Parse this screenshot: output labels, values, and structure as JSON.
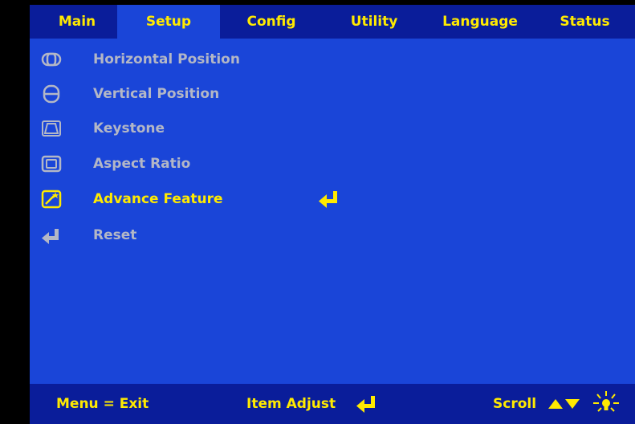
{
  "tabs": [
    {
      "label": "Main",
      "active": false
    },
    {
      "label": "Setup",
      "active": true
    },
    {
      "label": "Config",
      "active": false
    },
    {
      "label": "Utility",
      "active": false
    },
    {
      "label": "Language",
      "active": false
    },
    {
      "label": "Status",
      "active": false
    }
  ],
  "menu": {
    "items": [
      {
        "label": "Horizontal Position",
        "icon": "horizontal-position-icon",
        "state": "dim"
      },
      {
        "label": "Vertical Position",
        "icon": "vertical-position-icon",
        "state": "dim"
      },
      {
        "label": "Keystone",
        "icon": "keystone-icon",
        "state": "dim"
      },
      {
        "label": "Aspect Ratio",
        "icon": "aspect-ratio-icon",
        "state": "dim"
      },
      {
        "label": "Advance Feature",
        "icon": "advance-feature-icon",
        "state": "selected"
      },
      {
        "label": "Reset",
        "icon": "enter-arrow-icon",
        "state": "dim"
      }
    ],
    "selected_action_icon": "enter-arrow-icon"
  },
  "footer": {
    "menu_exit": "Menu = Exit",
    "item_adjust": "Item Adjust",
    "item_adjust_icon": "enter-arrow-icon",
    "scroll": "Scroll",
    "scroll_icons": [
      "up-triangle-icon",
      "down-triangle-icon"
    ],
    "brightness_icon": "lightbulb-icon"
  },
  "colors": {
    "bar_background": "#0a1d9a",
    "panel_background": "#1a45d8",
    "highlight_text": "#ffea00",
    "dim_text": "#b3b7c6"
  }
}
